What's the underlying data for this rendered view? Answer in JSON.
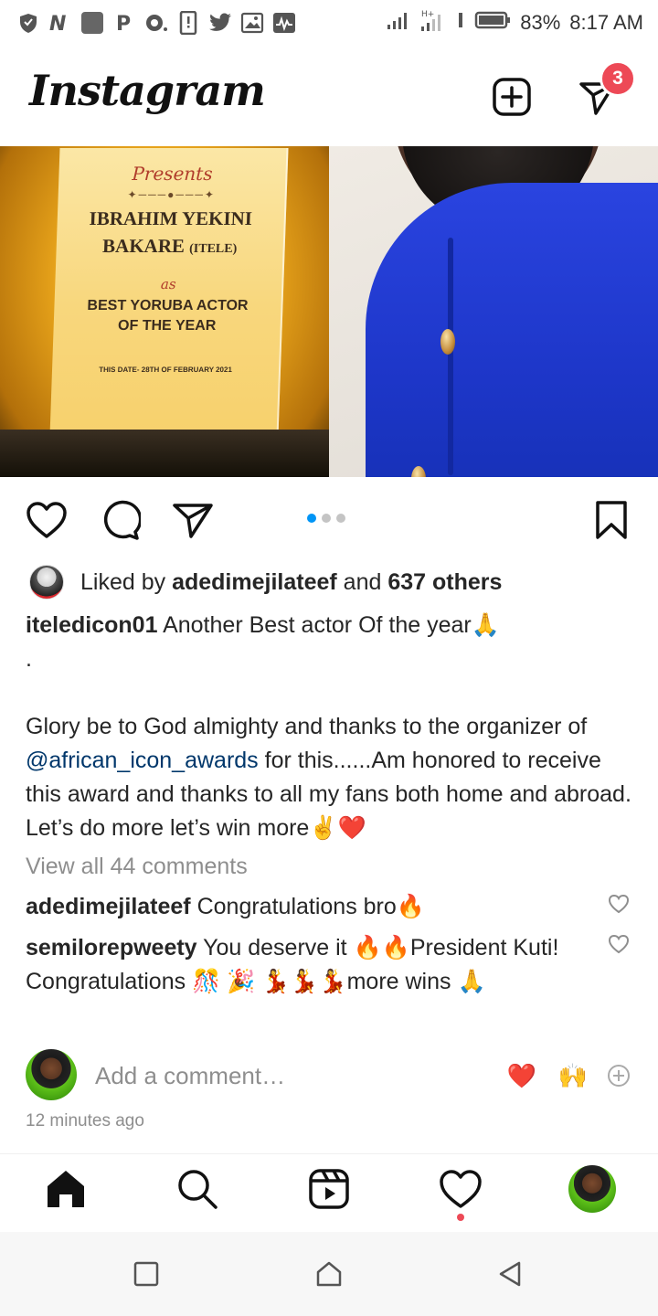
{
  "status_bar": {
    "battery": "83%",
    "time": "8:17 AM",
    "notification_icons": [
      "vpn-shield",
      "n-app",
      "square-app",
      "p-app",
      "opera-mini",
      "phone-notification",
      "twitter",
      "gallery",
      "activity"
    ],
    "right_icons": [
      "signal-1",
      "signal-2-h-plus",
      "vibrate",
      "battery"
    ]
  },
  "header": {
    "logo": "Instagram",
    "new_post_icon": "plus-square-icon",
    "direct_icon": "paper-plane-icon",
    "direct_badge": "3"
  },
  "post": {
    "plaque": {
      "presents": "Presents",
      "name_line1": "IBRAHIM YEKINI",
      "name_line2": "BAKARE",
      "name_suffix": "(ITELE)",
      "as": "as",
      "award_line1": "BEST YORUBA ACTOR",
      "award_line2": "OF THE YEAR",
      "date": "THIS DATE- 28TH OF FEBRUARY 2021"
    },
    "carousel": {
      "count": 3,
      "active": 1
    },
    "likes": {
      "prefix": "Liked by",
      "user": "adedimejilateef",
      "and": "and",
      "others": "637 others"
    },
    "caption": {
      "username": "iteledicon01",
      "line1": "Another Best actor Of the year🙏",
      "dot": ".",
      "body_before_mention": "Glory be to God almighty and thanks to  the organizer of",
      "mention": "@african_icon_awards",
      "body_after_mention": "for this......Am honored to receive this award and thanks to all my fans both home and abroad. Let’s do more let’s win more✌️❤️"
    },
    "view_all_comments": "View all 44 comments",
    "comments": [
      {
        "username": "adedimejilateef",
        "text": "Congratulations bro🔥"
      },
      {
        "username": "semilorepweety",
        "text": "You deserve it 🔥🔥President Kuti! Congratulations 🎊 🎉 💃💃💃more wins 🙏"
      }
    ],
    "add_comment": {
      "placeholder": "Add a comment…",
      "quick_emojis": [
        "❤️",
        "🙌"
      ]
    },
    "timestamp": "12 minutes ago"
  },
  "bottom_nav": {
    "items": [
      "home-icon",
      "search-icon",
      "reels-icon",
      "activity-heart-icon",
      "profile-avatar"
    ]
  },
  "system_nav": {
    "items": [
      "recents-square",
      "home-pentagon",
      "back-triangle"
    ]
  }
}
